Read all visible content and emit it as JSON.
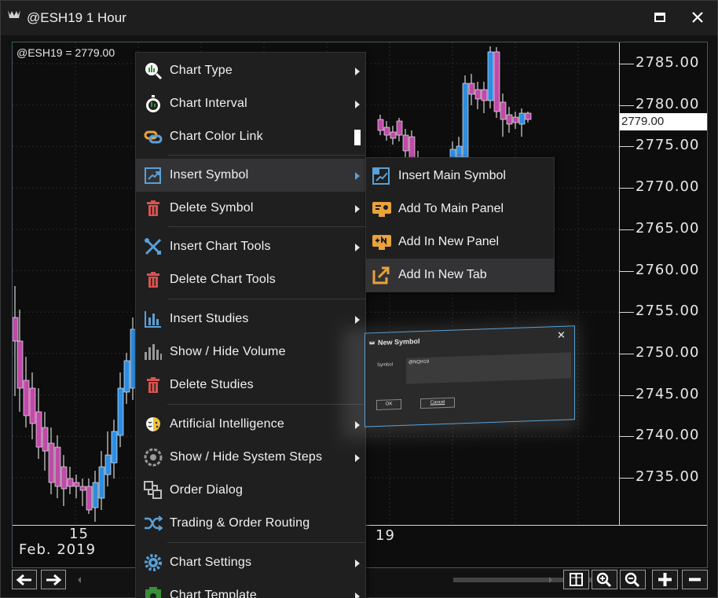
{
  "window": {
    "title": "@ESH19 1 Hour"
  },
  "chart": {
    "readout": "@ESH19 = 2779.00",
    "current_price": "2779.00",
    "price_labels": [
      "2785.00",
      "2780.00",
      "2775.00",
      "2770.00",
      "2765.00",
      "2760.00",
      "2755.00",
      "2750.00",
      "2745.00",
      "2740.00",
      "2735.00"
    ],
    "time_labels": {
      "day1": "15",
      "month": "Feb. 2019",
      "day2": "19"
    },
    "colors": {
      "up_candle": "#2e8de0",
      "down_candle": "#c04aa8",
      "axis_line": "#bfe0e6",
      "grid": "#2a2a2a"
    }
  },
  "context_menu": {
    "items": [
      {
        "label": "Chart Type",
        "icon": "chart-type-icon"
      },
      {
        "label": "Chart Interval",
        "icon": "stopwatch-icon"
      },
      {
        "label": "Chart Color Link",
        "icon": "link-icon"
      },
      {
        "label": "Insert Symbol",
        "icon": "insert-symbol-icon"
      },
      {
        "label": "Delete Symbol",
        "icon": "trash-icon"
      },
      {
        "label": "Insert Chart Tools",
        "icon": "tools-icon"
      },
      {
        "label": "Delete Chart Tools",
        "icon": "trash-icon"
      },
      {
        "label": "Insert Studies",
        "icon": "studies-icon"
      },
      {
        "label": "Show / Hide Volume",
        "icon": "volume-icon"
      },
      {
        "label": "Delete Studies",
        "icon": "trash-icon"
      },
      {
        "label": "Artificial Intelligence",
        "icon": "brain-icon"
      },
      {
        "label": "Show / Hide System Steps",
        "icon": "system-steps-icon"
      },
      {
        "label": "Order Dialog",
        "icon": "order-dialog-icon"
      },
      {
        "label": "Trading & Order Routing",
        "icon": "routing-icon"
      },
      {
        "label": "Chart Settings",
        "icon": "gear-icon"
      },
      {
        "label": "Chart Template",
        "icon": "template-icon"
      }
    ]
  },
  "submenu": {
    "items": [
      {
        "label": "Insert Main Symbol",
        "icon": "insert-main-symbol-icon"
      },
      {
        "label": "Add To Main Panel",
        "icon": "add-main-panel-icon"
      },
      {
        "label": "Add In New Panel",
        "icon": "add-new-panel-icon"
      },
      {
        "label": "Add In New Tab",
        "icon": "new-tab-icon"
      }
    ]
  },
  "dialog": {
    "title": "New Symbol",
    "symbol_label": "Symbol",
    "symbol_value": "@NQH19",
    "ok_label": "OK",
    "cancel_label": "Cancel"
  }
}
